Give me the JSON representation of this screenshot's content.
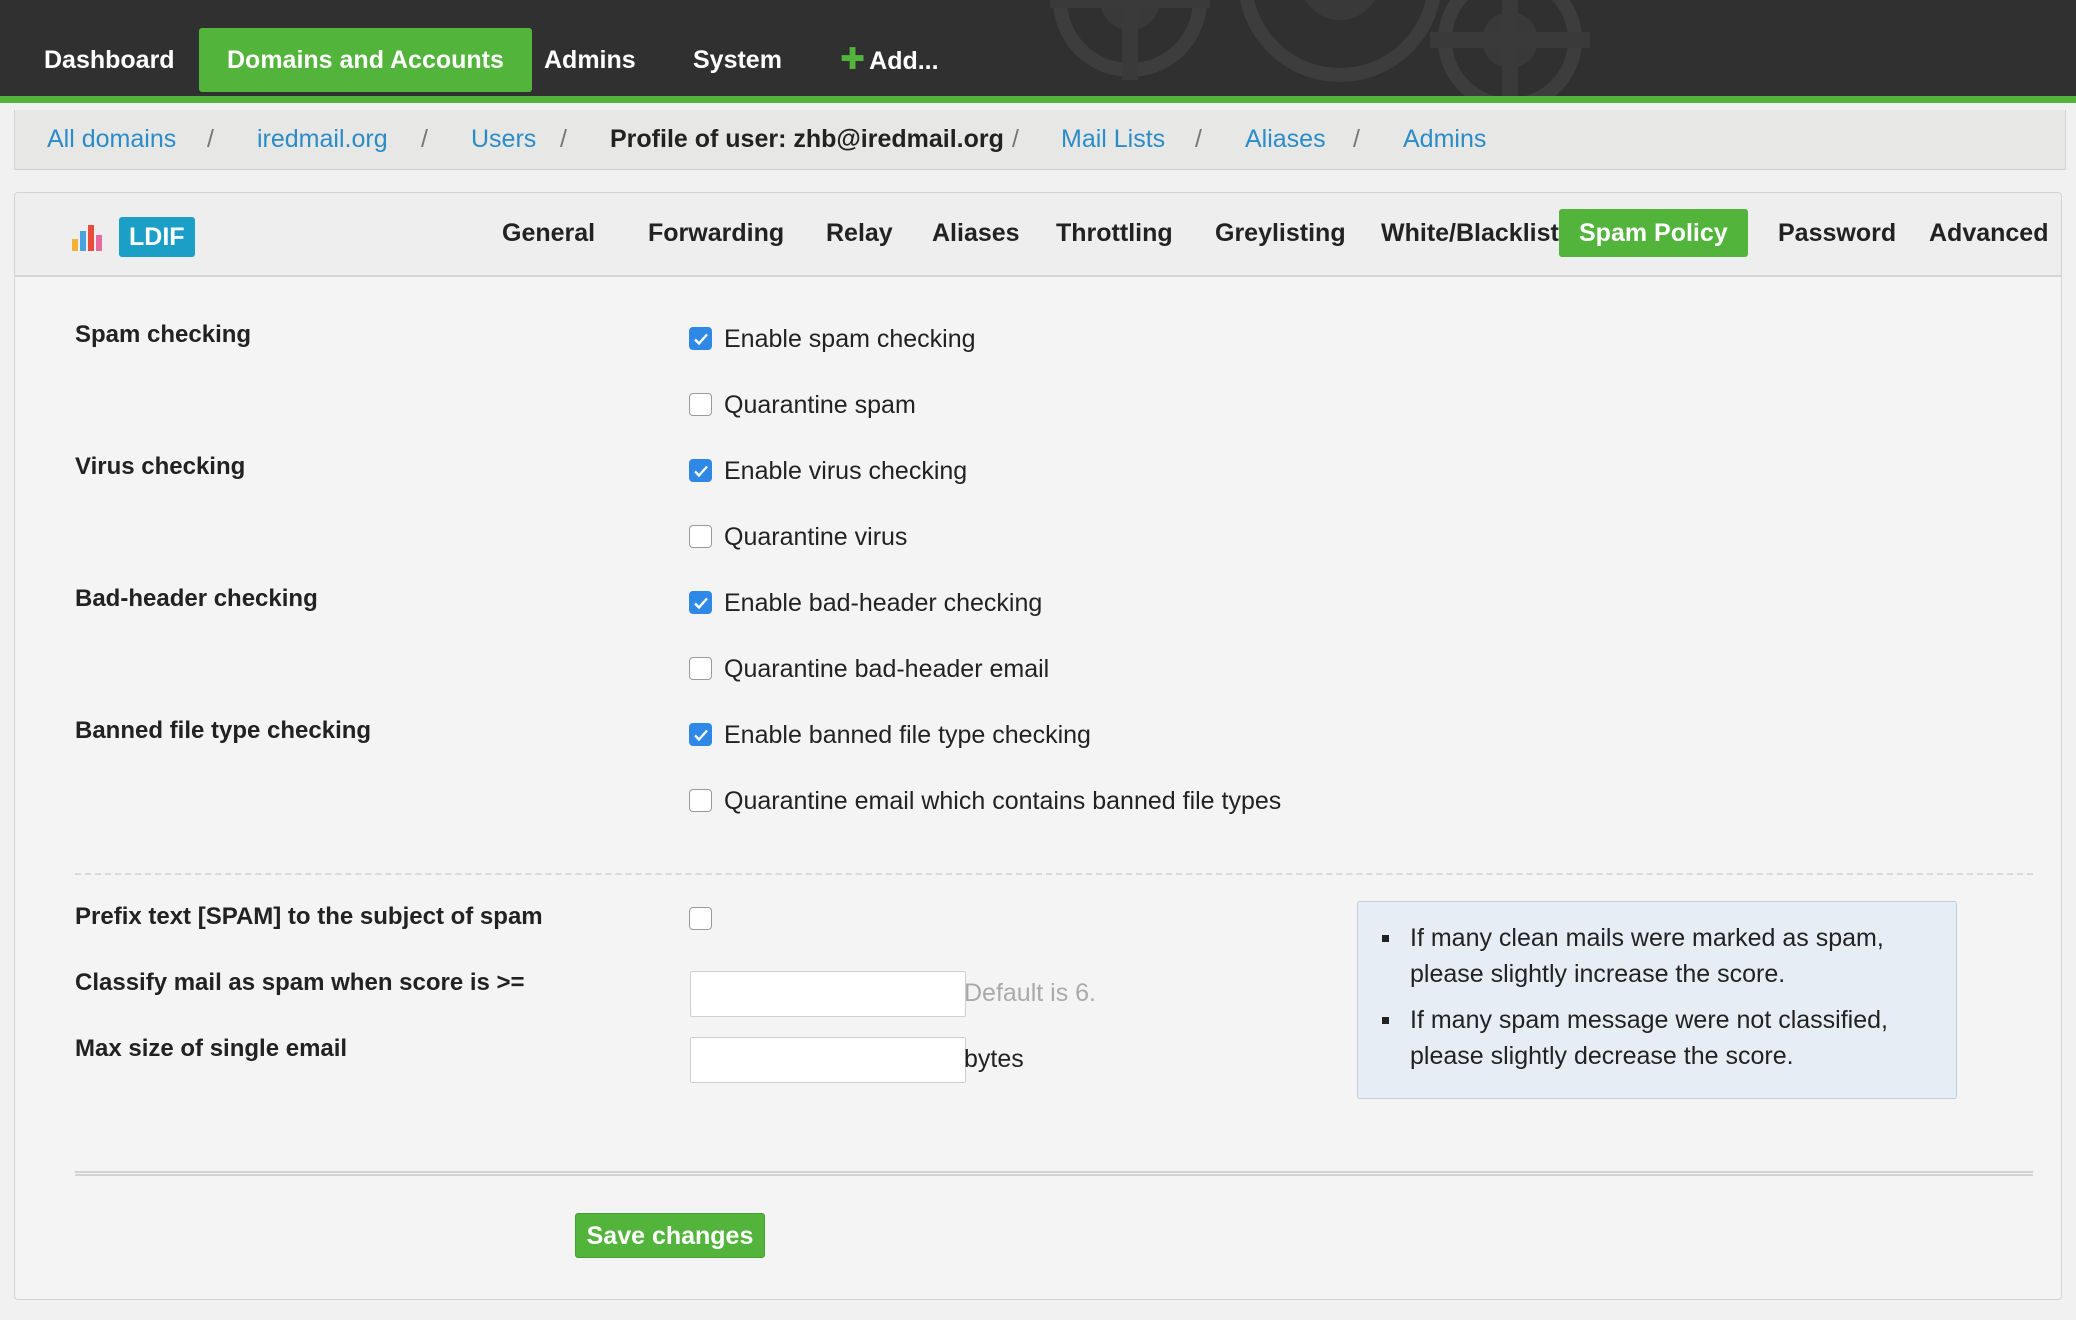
{
  "nav": {
    "items": [
      {
        "label": "Dashboard",
        "active": false
      },
      {
        "label": "Domains and Accounts",
        "active": true
      },
      {
        "label": "Admins",
        "active": false
      },
      {
        "label": "System",
        "active": false
      },
      {
        "label": "Add...",
        "active": false
      }
    ],
    "add_icon": "plus-icon"
  },
  "breadcrumb": {
    "all_domains": "All domains",
    "domain": "iredmail.org",
    "users": "Users",
    "current": "Profile of user: zhb@iredmail.org",
    "mail_lists": "Mail Lists",
    "aliases": "Aliases",
    "admins": "Admins",
    "separator": "/"
  },
  "toolbar": {
    "chart_icon": "bar-chart-icon",
    "ldif": "LDIF"
  },
  "tabs": [
    {
      "label": "General",
      "active": false
    },
    {
      "label": "Forwarding",
      "active": false
    },
    {
      "label": "Relay",
      "active": false
    },
    {
      "label": "Aliases",
      "active": false
    },
    {
      "label": "Throttling",
      "active": false
    },
    {
      "label": "Greylisting",
      "active": false
    },
    {
      "label": "White/Blacklist",
      "active": false
    },
    {
      "label": "Spam Policy",
      "active": true
    },
    {
      "label": "Password",
      "active": false
    },
    {
      "label": "Advanced",
      "active": false
    }
  ],
  "form": {
    "spam_label": "Spam checking",
    "enable_spam": {
      "label": "Enable spam checking",
      "checked": true
    },
    "quarantine_spam": {
      "label": "Quarantine spam",
      "checked": false
    },
    "virus_label": "Virus checking",
    "enable_virus": {
      "label": "Enable virus checking",
      "checked": true
    },
    "quarantine_virus": {
      "label": "Quarantine virus",
      "checked": false
    },
    "badheader_label": "Bad-header checking",
    "enable_badheader": {
      "label": "Enable bad-header checking",
      "checked": true
    },
    "quarantine_badheader": {
      "label": "Quarantine bad-header email",
      "checked": false
    },
    "banned_label": "Banned file type checking",
    "enable_banned": {
      "label": "Enable banned file type checking",
      "checked": true
    },
    "quarantine_banned": {
      "label": "Quarantine email which contains banned file types",
      "checked": false
    },
    "prefix_label": "Prefix text [SPAM] to the subject of spam",
    "prefix_checked": false,
    "score_label": "Classify mail as spam when score is >=",
    "score_value": "",
    "score_hint": "Default is 6.",
    "maxsize_label": "Max size of single email",
    "maxsize_value": "",
    "maxsize_unit": "bytes",
    "save": "Save changes"
  },
  "tips": [
    "If many clean mails were marked as spam, please slightly increase the score.",
    "If many spam message were not classified, please slightly decrease the score."
  ],
  "colors": {
    "accent": "#52b43a",
    "link": "#2a8cc8",
    "checkbox": "#2e88e6",
    "ldif": "#1b9fc7"
  }
}
